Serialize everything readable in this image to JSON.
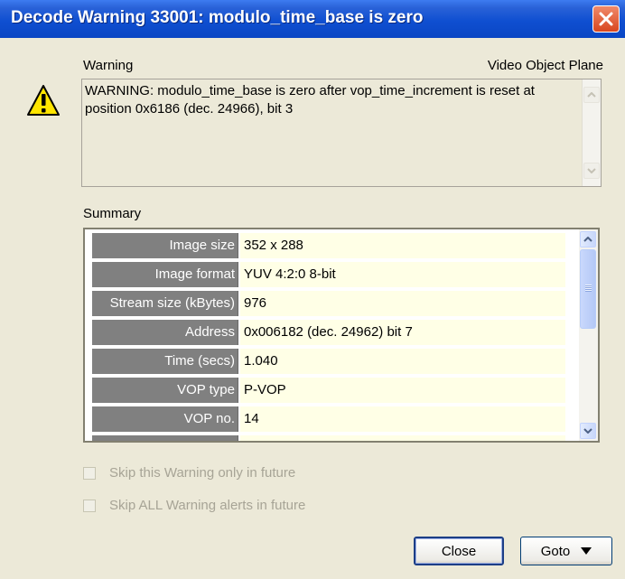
{
  "window": {
    "title": "Decode Warning 33001: modulo_time_base is zero",
    "close_icon": "close-icon"
  },
  "warning": {
    "icon": "warning-icon",
    "heading": "Warning",
    "category": "Video Object Plane",
    "message": "WARNING: modulo_time_base is zero after vop_time_increment is reset at position 0x6186 (dec. 24966), bit 3"
  },
  "summary": {
    "heading": "Summary",
    "rows": [
      {
        "label": "Image size",
        "value": "352 x 288"
      },
      {
        "label": "Image format",
        "value": "YUV 4:2:0 8-bit"
      },
      {
        "label": "Stream size (kBytes)",
        "value": "976"
      },
      {
        "label": "Address",
        "value": "0x006182 (dec. 24962) bit 7"
      },
      {
        "label": "Time (secs)",
        "value": "1.040"
      },
      {
        "label": "VOP type",
        "value": "P-VOP"
      },
      {
        "label": "VOP no.",
        "value": "14"
      }
    ]
  },
  "options": {
    "skip_this": "Skip this Warning only in future",
    "skip_all": "Skip ALL Warning alerts in future"
  },
  "buttons": {
    "close": "Close",
    "goto": "Goto"
  }
}
